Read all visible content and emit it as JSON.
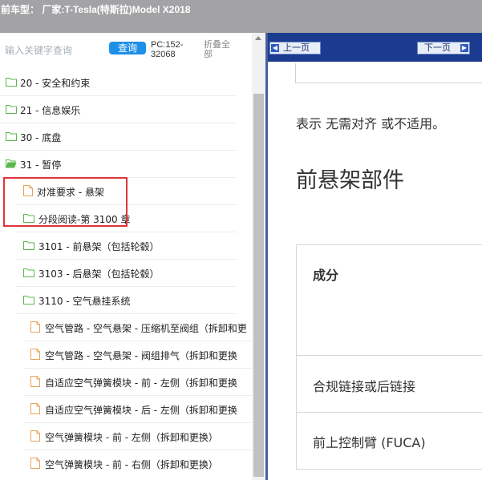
{
  "title_bar": {
    "text": "前车型： 厂家:T-Tesla(特斯拉)Model X2018"
  },
  "search": {
    "placeholder": "输入关键字查询",
    "query_button": "查询",
    "pc_line1": "PC:152-",
    "pc_line2": "32068",
    "collapse_line1": "折叠全",
    "collapse_line2": "部"
  },
  "tree": [
    {
      "label": "20 - 安全和约束",
      "type": "folder"
    },
    {
      "label": "21 - 信息娱乐",
      "type": "folder"
    },
    {
      "label": "30 - 底盘",
      "type": "folder"
    },
    {
      "label": "31 - 暂停",
      "type": "folder-open"
    },
    {
      "label": "对准要求 - 悬架",
      "type": "doc"
    },
    {
      "label": "分段阅读-第 3100 章",
      "type": "folder"
    },
    {
      "label": "3101 - 前悬架（包括轮毂）",
      "type": "folder"
    },
    {
      "label": "3103 - 后悬架（包括轮毂）",
      "type": "folder"
    },
    {
      "label": "3110 - 空气悬挂系统",
      "type": "folder"
    },
    {
      "label": "空气管路 - 空气悬架 - 压缩机至阀组（拆卸和更",
      "type": "doc"
    },
    {
      "label": "空气管路 - 空气悬架 - 阀组排气（拆卸和更换",
      "type": "doc"
    },
    {
      "label": "自适应空气弹簧模块 - 前 - 左侧（拆卸和更换",
      "type": "doc"
    },
    {
      "label": "自适应空气弹簧模块 - 后 - 左侧（拆卸和更换",
      "type": "doc"
    },
    {
      "label": "空气弹簧模块 - 前 - 左侧（拆卸和更换）",
      "type": "doc"
    },
    {
      "label": "空气弹簧模块 - 前 - 右侧（拆卸和更换）",
      "type": "doc"
    }
  ],
  "nav": {
    "prev_label": "上一页",
    "next_label": "下一页"
  },
  "content": {
    "note": "表示 无需对齐 或不适用。",
    "heading": "前悬架部件",
    "table_header": "成分",
    "rows": [
      "合规链接或后链接",
      "前上控制臂 (FUCA)"
    ]
  },
  "colors": {
    "title_bar_bg": "#a3a3a6",
    "query_button_bg": "#1e90e8",
    "nav_bar_bg": "#1a3b8f",
    "folder_icon": "#5ab84c",
    "doc_icon": "#e8a35a",
    "highlight_border": "#e0343a"
  }
}
